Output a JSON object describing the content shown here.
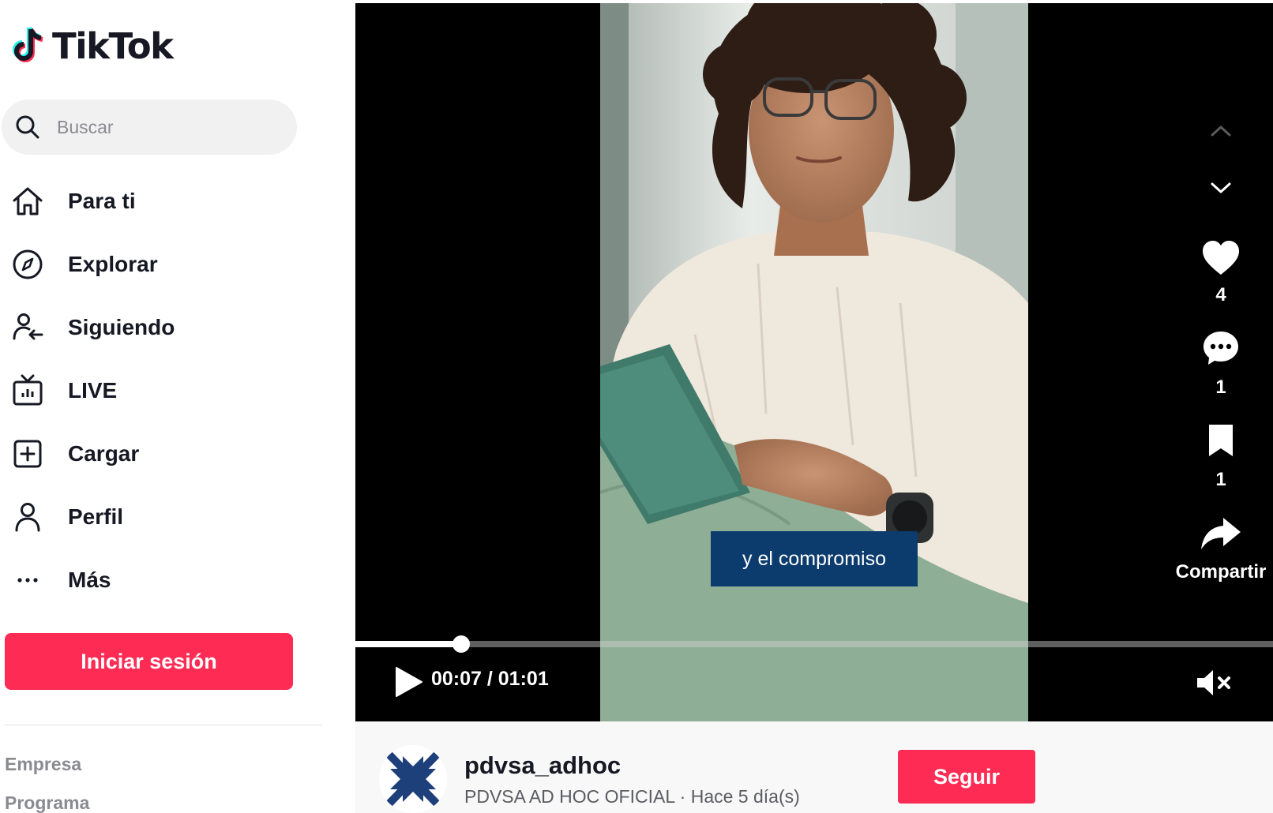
{
  "app": {
    "brand": "TikTok",
    "accent": "#fe2c55",
    "logo_icon": "tiktok-note-icon"
  },
  "search": {
    "placeholder": "Buscar",
    "icon": "search-icon"
  },
  "nav": {
    "items": [
      {
        "label": "Para ti",
        "icon": "home-icon"
      },
      {
        "label": "Explorar",
        "icon": "compass-icon"
      },
      {
        "label": "Siguiendo",
        "icon": "following-icon"
      },
      {
        "label": "LIVE",
        "icon": "live-tv-icon"
      },
      {
        "label": "Cargar",
        "icon": "upload-icon"
      },
      {
        "label": "Perfil",
        "icon": "profile-icon"
      },
      {
        "label": "Más",
        "icon": "more-icon"
      }
    ]
  },
  "login": {
    "label": "Iniciar sesión"
  },
  "footer": {
    "links": [
      "Empresa",
      "Programa"
    ]
  },
  "video": {
    "caption": "y el compromiso",
    "current_time": "00:07",
    "duration": "01:01",
    "time_display": "00:07 / 01:01",
    "progress": 0.115,
    "muted": true
  },
  "actions": {
    "likes": "4",
    "comments": "1",
    "saves": "1",
    "share_label": "Compartir"
  },
  "author": {
    "handle": "pdvsa_adhoc",
    "display_name": "PDVSA AD HOC OFICIAL",
    "posted": "Hace 5 día(s)",
    "subline": "PDVSA AD HOC OFICIAL · Hace 5 día(s)",
    "follow_label": "Seguir",
    "avatar_color": "#1d3f7a"
  }
}
